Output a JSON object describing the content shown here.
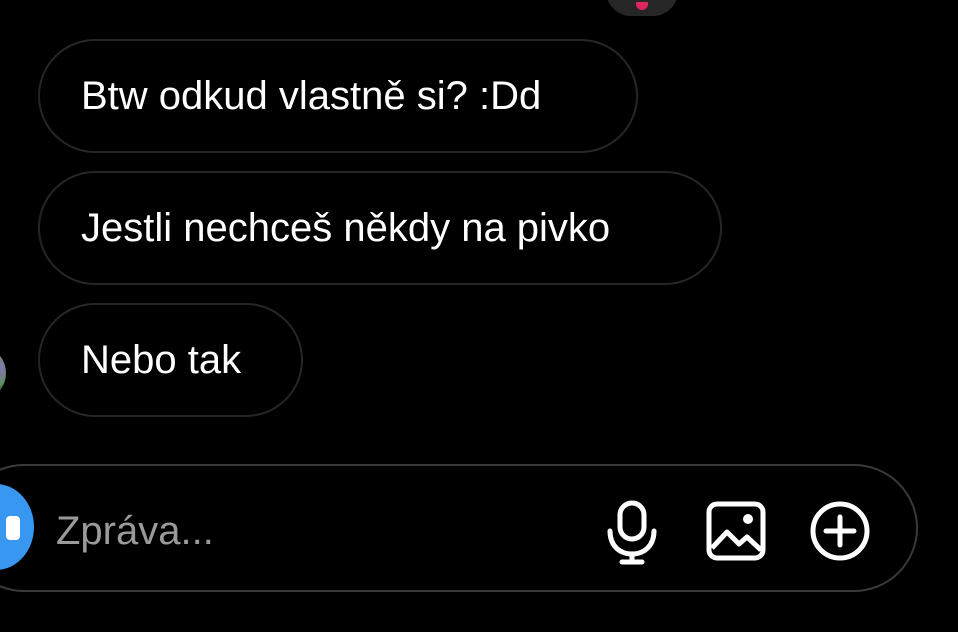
{
  "chat": {
    "messages": [
      {
        "text": "Btw odkud vlastně si? :Dd"
      },
      {
        "text": "Jestli nechceš někdy na pivko"
      },
      {
        "text": "Nebo tak"
      }
    ]
  },
  "composer": {
    "placeholder": "Zpráva...",
    "icons": [
      "camera-icon",
      "microphone-icon",
      "gallery-icon",
      "add-icon"
    ],
    "accent_color": "#3897f0"
  },
  "colors": {
    "background": "#000000",
    "bubble_border": "#262626",
    "text": "#ffffff",
    "placeholder": "#9a9a9a"
  }
}
